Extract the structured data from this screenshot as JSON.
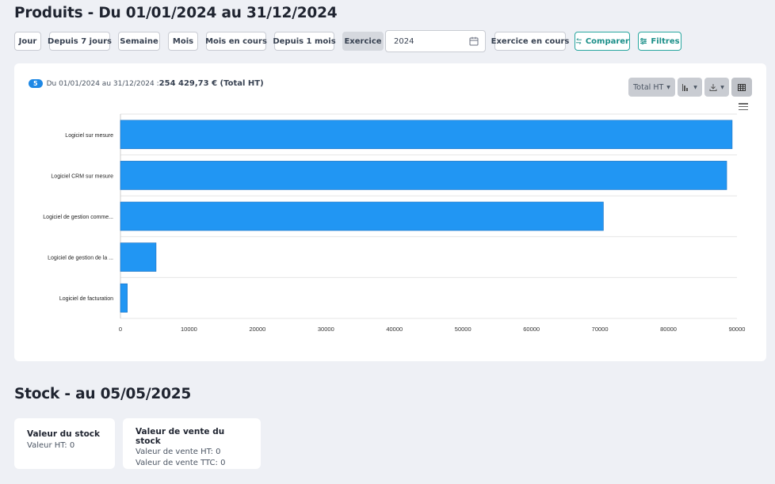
{
  "page_title": "Produits - Du 01/01/2024 au 31/12/2024",
  "toolbar": {
    "periods": [
      "Jour",
      "Depuis 7 jours",
      "Semaine",
      "Mois",
      "Mois en cours",
      "Depuis 1 mois",
      "Exercice"
    ],
    "active_period": "Exercice",
    "year_value": "2024",
    "current_fiscal": "Exercice en cours",
    "compare_label": "Comparer",
    "filters_label": "Filtres"
  },
  "summary": {
    "badge": "5",
    "range": "Du 01/01/2024 au 31/12/2024 : ",
    "total": "254 429,73 € (Total HT)"
  },
  "controls": {
    "measure_label": "Total HT",
    "chart_type_icon": "bar-chart-icon",
    "download_icon": "download-icon",
    "table_icon": "table-icon",
    "menu_icon": "hamburger-menu-icon"
  },
  "chart_data": {
    "type": "bar",
    "orientation": "horizontal",
    "categories": [
      "Logiciel sur mesure",
      "Logiciel CRM sur mesure",
      "Logiciel de gestion comme...",
      "Logiciel de gestion de la ...",
      "Logiciel de facturation"
    ],
    "values": [
      89300,
      88500,
      70500,
      5200,
      1000
    ],
    "x_ticks": [
      0,
      10000,
      20000,
      30000,
      40000,
      50000,
      60000,
      70000,
      80000,
      90000
    ],
    "xlim": [
      0,
      90000
    ],
    "bar_color": "#2196f3",
    "grid": true
  },
  "stock": {
    "title": "Stock - au 05/05/2025",
    "value_card": {
      "title": "Valeur du stock",
      "line1": "Valeur HT: 0"
    },
    "sale_card": {
      "title": "Valeur de vente du stock",
      "line1": "Valeur de vente HT: 0",
      "line2": "Valeur de vente TTC: 0"
    }
  }
}
